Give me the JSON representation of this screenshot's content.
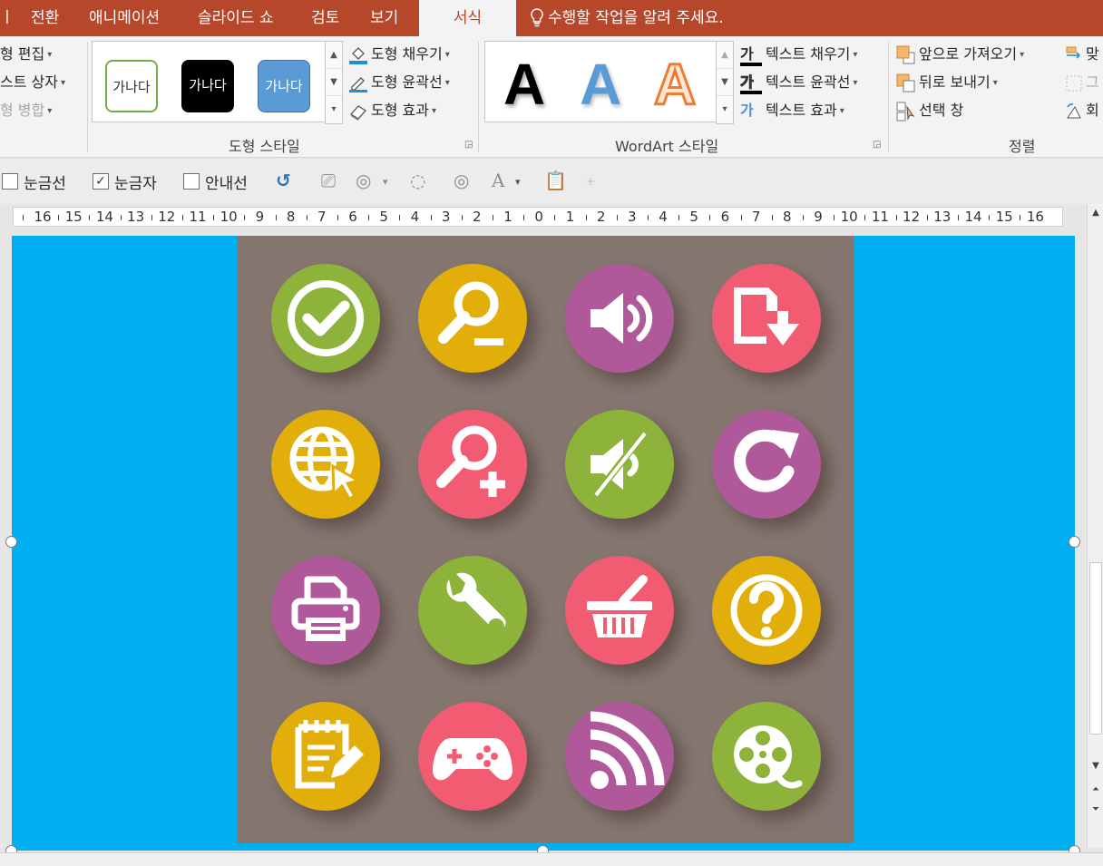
{
  "tabs": [
    {
      "label": "ㅣ",
      "active": false
    },
    {
      "label": "전환",
      "active": false
    },
    {
      "label": "애니메이션",
      "active": false
    },
    {
      "label": "슬라이드 쇼",
      "active": false
    },
    {
      "label": "검토",
      "active": false
    },
    {
      "label": "보기",
      "active": false
    },
    {
      "label": "서식",
      "active": true
    }
  ],
  "tell_me": "수행할 작업을 알려 주세요.",
  "ribbon": {
    "insert_shapes": {
      "edit_shape": "형 편집",
      "text_box": "스트 상자",
      "merge_shapes": "형 병합"
    },
    "shape_styles": {
      "label": "도형 스타일",
      "swatches": [
        "가나다",
        "가나다",
        "가나다"
      ],
      "fill": "도형 채우기",
      "outline": "도형 윤곽선",
      "effects": "도형 효과"
    },
    "wordart": {
      "label": "WordArt 스타일",
      "letters": [
        "A",
        "A",
        "A"
      ],
      "text_fill": "텍스트 채우기",
      "text_outline": "텍스트 윤곽선",
      "text_effects": "텍스트 효과",
      "glyph": "가"
    },
    "arrange": {
      "label": "정렬",
      "bring_forward": "앞으로 가져오기",
      "send_backward": "뒤로 보내기",
      "selection_pane": "선택 창",
      "align": "맞",
      "group": "그",
      "rotate": "회"
    }
  },
  "quickbar": {
    "gridlines": {
      "label": "눈금선",
      "checked": false
    },
    "ruler": {
      "label": "눈금자",
      "checked": true
    },
    "guides": {
      "label": "안내선",
      "checked": false
    },
    "text_a": "A"
  },
  "ruler_numbers": [
    "16",
    "15",
    "14",
    "13",
    "12",
    "11",
    "10",
    "9",
    "8",
    "7",
    "6",
    "5",
    "4",
    "3",
    "2",
    "1",
    "0",
    "1",
    "2",
    "3",
    "4",
    "5",
    "6",
    "7",
    "8",
    "9",
    "10",
    "11",
    "12",
    "13",
    "14",
    "15",
    "16"
  ],
  "colors": {
    "tabbar": "#b7472a",
    "slide_bg": "#00b0f0",
    "panel_bg": "#857670",
    "green": "#8db33a",
    "yellow": "#e1ae0a",
    "purple": "#b0599a",
    "pink": "#f25c73"
  },
  "icons": [
    [
      "check-icon",
      "search-minus-icon",
      "volume-icon",
      "save-download-icon"
    ],
    [
      "globe-cursor-icon",
      "search-plus-icon",
      "mute-icon",
      "refresh-icon"
    ],
    [
      "printer-icon",
      "wrench-icon",
      "basket-icon",
      "help-icon"
    ],
    [
      "notepad-icon",
      "gamepad-icon",
      "rss-icon",
      "film-reel-icon"
    ]
  ],
  "icon_colors": [
    [
      "green",
      "yellow",
      "purple",
      "pink"
    ],
    [
      "yellow",
      "pink",
      "green",
      "purple"
    ],
    [
      "purple",
      "green",
      "pink",
      "yellow"
    ],
    [
      "yellow",
      "pink",
      "purple",
      "green"
    ]
  ]
}
